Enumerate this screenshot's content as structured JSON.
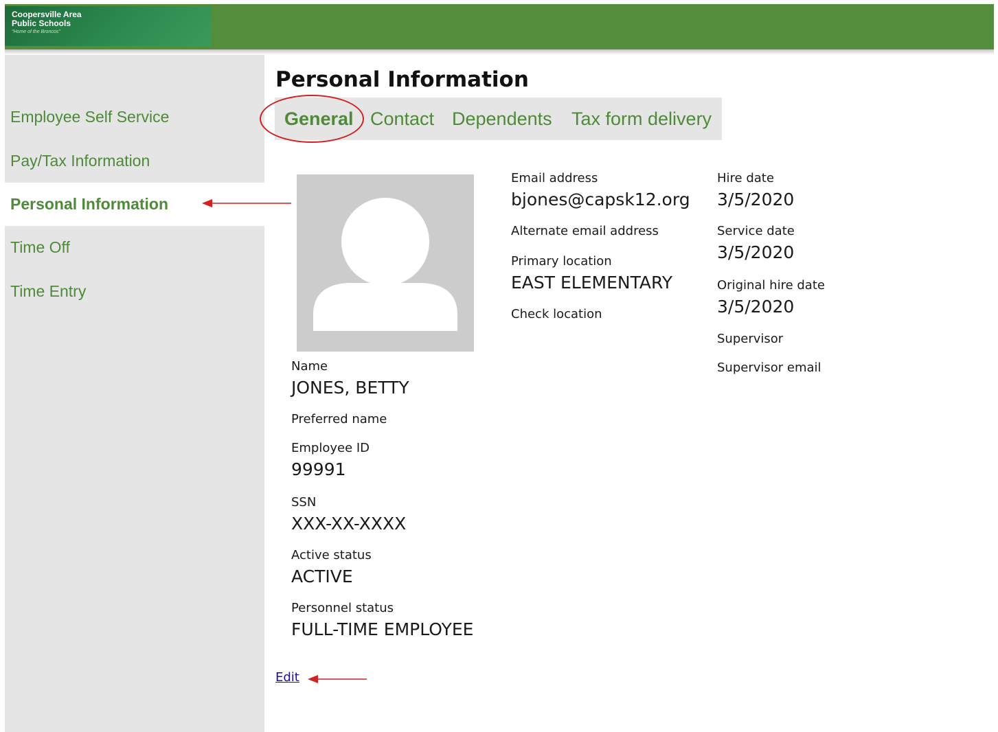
{
  "header": {
    "logo_line1": "Coopersville Area",
    "logo_line2": "Public Schools",
    "logo_tagline": "\"Home of the Broncos\""
  },
  "sidebar": {
    "items": [
      {
        "label": "Employee Self Service",
        "active": false
      },
      {
        "label": "Pay/Tax Information",
        "active": false
      },
      {
        "label": "Personal Information",
        "active": true
      },
      {
        "label": "Time Off",
        "active": false
      },
      {
        "label": "Time Entry",
        "active": false
      }
    ]
  },
  "page": {
    "title": "Personal Information",
    "tabs": [
      {
        "label": "General",
        "active": true
      },
      {
        "label": "Contact",
        "active": false
      },
      {
        "label": "Dependents",
        "active": false
      },
      {
        "label": "Tax form delivery",
        "active": false
      }
    ]
  },
  "profile": {
    "name_label": "Name",
    "name_value": "JONES, BETTY",
    "preferred_name_label": "Preferred name",
    "employee_id_label": "Employee ID",
    "employee_id_value": "99991",
    "ssn_label": "SSN",
    "ssn_value": "XXX-XX-XXXX",
    "active_status_label": "Active status",
    "active_status_value": "ACTIVE",
    "personnel_status_label": "Personnel status",
    "personnel_status_value": "FULL-TIME EMPLOYEE"
  },
  "contact": {
    "email_label": "Email address",
    "email_value": "bjones@capsk12.org",
    "alt_email_label": "Alternate email address",
    "primary_location_label": "Primary location",
    "primary_location_value": "EAST ELEMENTARY",
    "check_location_label": "Check location"
  },
  "employment": {
    "hire_date_label": "Hire date",
    "hire_date_value": "3/5/2020",
    "service_date_label": "Service date",
    "service_date_value": "3/5/2020",
    "original_hire_date_label": "Original hire date",
    "original_hire_date_value": "3/5/2020",
    "supervisor_label": "Supervisor",
    "supervisor_email_label": "Supervisor email"
  },
  "actions": {
    "edit_label": "Edit"
  },
  "colors": {
    "brand_green": "#548e3c",
    "nav_text": "#4e8a38",
    "annotation_red": "#d42020",
    "link_blue": "#1a0dab"
  },
  "icons": {
    "avatar": "user-placeholder-icon",
    "annotation": "red-arrow-icon"
  }
}
